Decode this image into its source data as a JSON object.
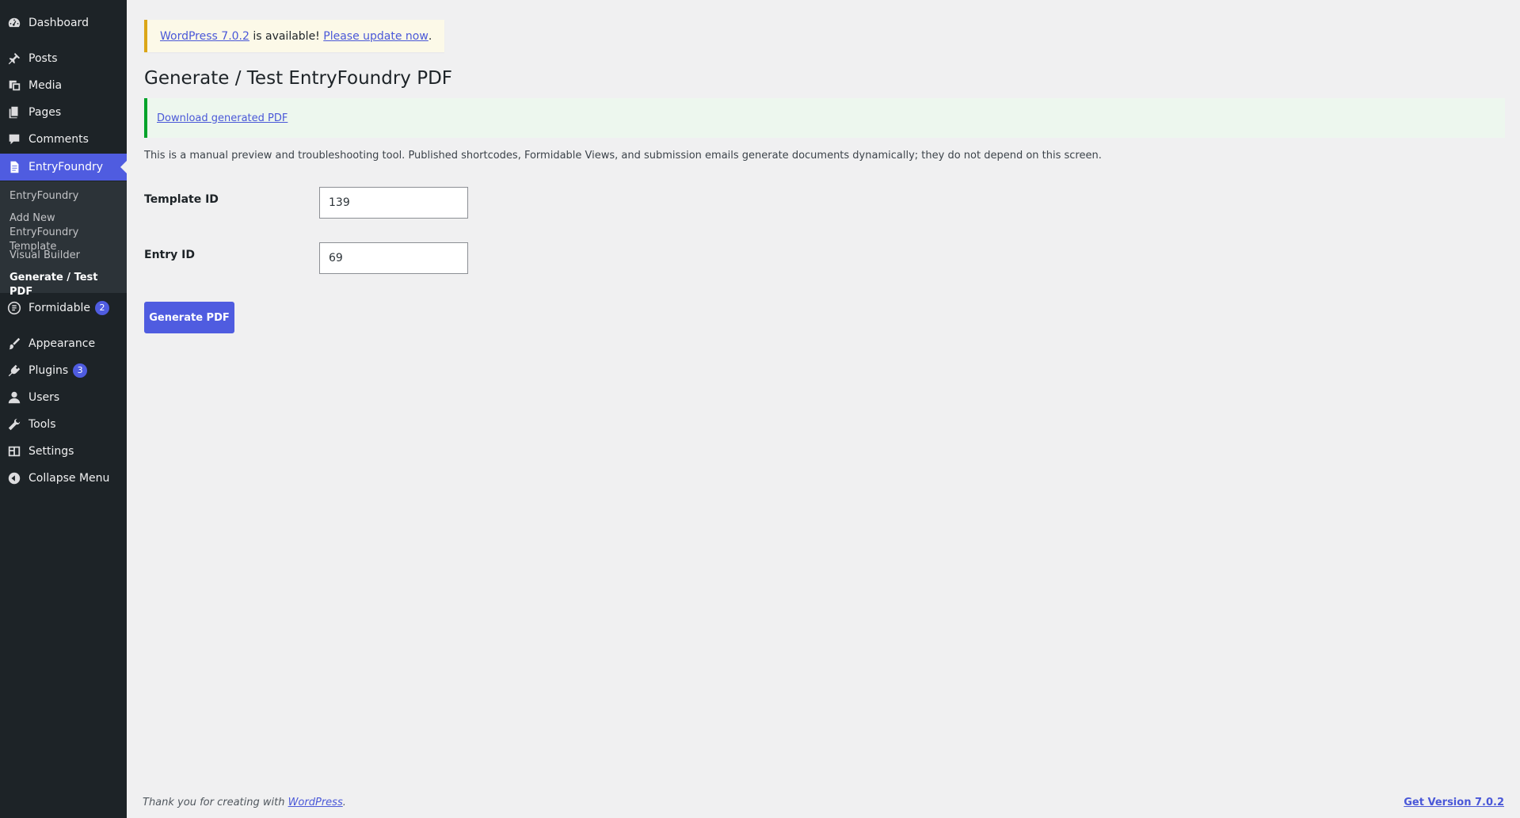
{
  "sidebar": {
    "items": [
      {
        "label": "Dashboard",
        "icon": "dashboard-icon"
      },
      {
        "label": "Posts",
        "icon": "pin-icon"
      },
      {
        "label": "Media",
        "icon": "media-icon"
      },
      {
        "label": "Pages",
        "icon": "pages-icon"
      },
      {
        "label": "Comments",
        "icon": "comment-icon"
      },
      {
        "label": "EntryFoundry",
        "icon": "document-icon"
      },
      {
        "label": "Formidable",
        "icon": "formidable-icon",
        "badge": "2"
      },
      {
        "label": "Appearance",
        "icon": "brush-icon"
      },
      {
        "label": "Plugins",
        "icon": "plugin-icon",
        "badge": "3"
      },
      {
        "label": "Users",
        "icon": "user-icon"
      },
      {
        "label": "Tools",
        "icon": "wrench-icon"
      },
      {
        "label": "Settings",
        "icon": "settings-icon"
      },
      {
        "label": "Collapse Menu",
        "icon": "collapse-icon"
      }
    ],
    "submenu": [
      {
        "label": "EntryFoundry"
      },
      {
        "label": "Add New EntryFoundry Template"
      },
      {
        "label": "Visual Builder"
      },
      {
        "label": "Generate / Test PDF"
      }
    ]
  },
  "notice": {
    "update_link": "WordPress 7.0.2",
    "update_text": " is available! ",
    "update_now": "Please update now",
    "period": "."
  },
  "page": {
    "title": "Generate / Test EntryFoundry PDF",
    "download_link": "Download generated PDF",
    "description": "This is a manual preview and troubleshooting tool. Published shortcodes, Formidable Views, and submission emails generate documents dynamically; they do not depend on this screen.",
    "template_label": "Template ID",
    "template_value": "139",
    "entry_label": "Entry ID",
    "entry_value": "69",
    "generate_button": "Generate PDF"
  },
  "footer": {
    "thanks": "Thank you for creating with ",
    "wp_link": "WordPress",
    "period": ".",
    "version_link": "Get Version 7.0.2"
  },
  "colors": {
    "sidebar_bg": "#1d2327",
    "accent": "#4f5ce0",
    "background": "#f0f0f1"
  }
}
